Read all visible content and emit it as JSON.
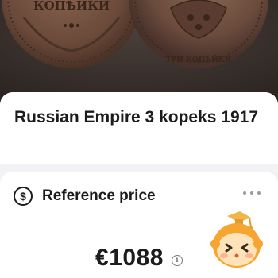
{
  "photo": {
    "coin_left_text": "КОПѢЙКИ",
    "coin_right_text": "ТРИ КОПѢЙКИ"
  },
  "listing": {
    "title": "Russian Empire 3 kopeks 1917"
  },
  "reference_price": {
    "icon": "dollar-circle-icon",
    "label": "Reference price",
    "value": "€1088",
    "info_icon_glyph": "i",
    "more_icon": "more-dots-icon"
  },
  "mascot": {
    "icon": "graduate-mascot-icon"
  },
  "colors": {
    "text": "#1c1c1e",
    "background": "#f2f2f4",
    "card": "#ffffff",
    "coin_bronze": "#6b4a3a",
    "mascot_orange": "#f5a623"
  }
}
